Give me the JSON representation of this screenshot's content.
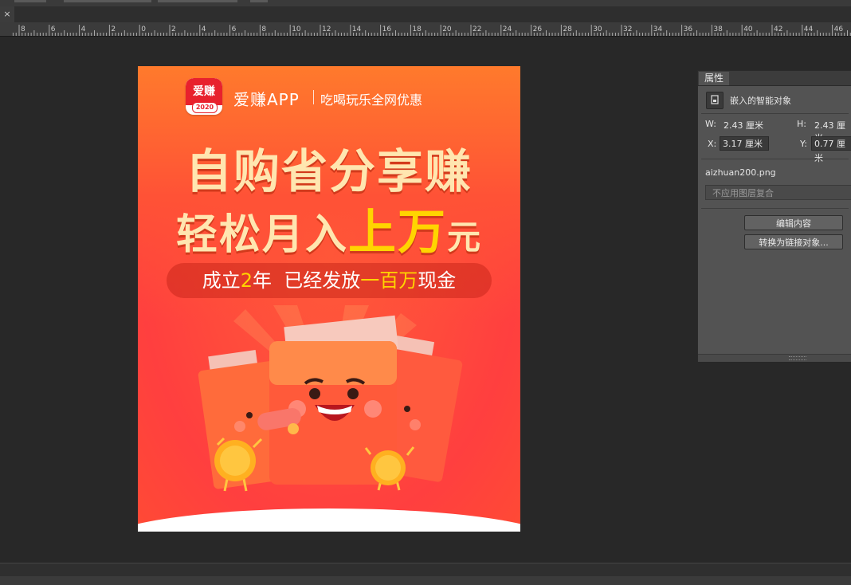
{
  "window": {
    "close_glyph": "×"
  },
  "ruler": {
    "labels": [
      "8",
      "6",
      "4",
      "2",
      "0",
      "2",
      "4",
      "6",
      "8",
      "10",
      "12",
      "14",
      "16",
      "18",
      "20",
      "22",
      "24",
      "26",
      "28",
      "30",
      "32",
      "34",
      "36",
      "38",
      "40",
      "42",
      "44",
      "46"
    ]
  },
  "artwork": {
    "logo": {
      "text": "爱赚",
      "year": "2020"
    },
    "brand": "爱赚APP",
    "slogan": "吃喝玩乐全网优惠",
    "title_line1": "自购省分享赚",
    "title_line2_part1": "轻松月入",
    "title_line2_highlight": "上万",
    "title_line2_part2": "元",
    "pill": {
      "p1": "成立",
      "y1": "2",
      "p2": "年  已经发放",
      "y2": "一百万",
      "p3": "现金"
    },
    "illustration": "cartoon-red-envelopes-with-coins"
  },
  "properties_panel": {
    "tab": "属性",
    "object_type": "嵌入的智能对象",
    "w_label": "W:",
    "w_value": "2.43 厘米",
    "h_label": "H:",
    "h_value": "2.43 厘米",
    "x_label": "X:",
    "x_value": "3.17 厘米",
    "y_label": "Y:",
    "y_value": "0.77 厘米",
    "filename": "aizhuan200.png",
    "layer_comp": "不应用图层复合",
    "edit_button": "编辑内容",
    "convert_button": "转换为链接对象..."
  },
  "colors": {
    "app_bg": "#282828",
    "panel_bg": "#535353",
    "poster_red": "#ff4a3c",
    "poster_gold": "#ffe6b0",
    "poster_yellow": "#ffd400"
  }
}
